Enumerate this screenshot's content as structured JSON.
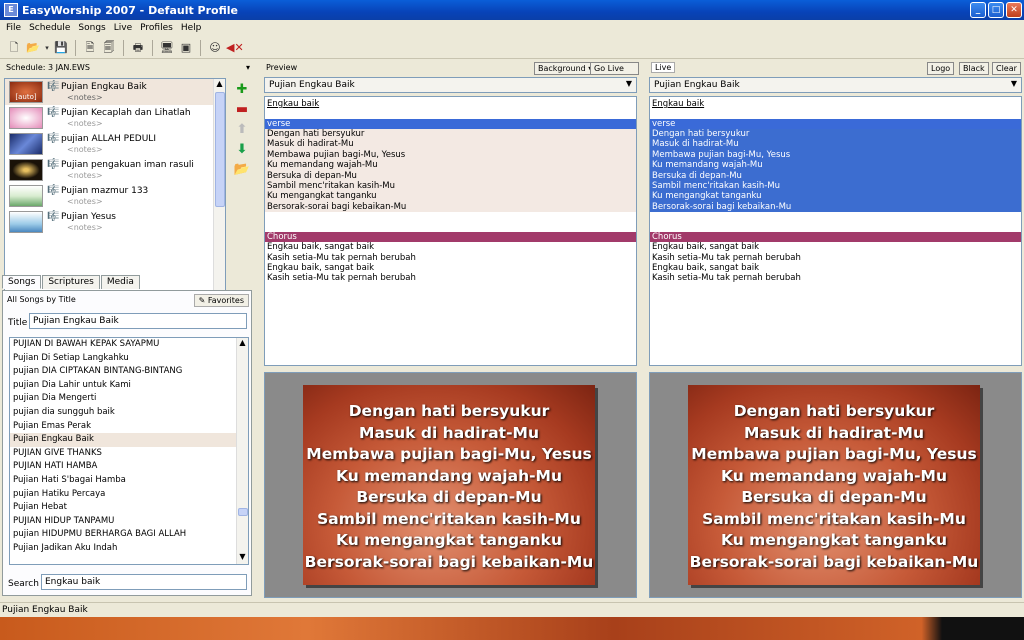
{
  "window": {
    "title": "EasyWorship 2007 - Default Profile"
  },
  "menu": [
    "File",
    "Schedule",
    "Songs",
    "Live",
    "Profiles",
    "Help"
  ],
  "schedule": {
    "label": "Schedule: 3 JAN.EWS",
    "items": [
      {
        "title": "Pujian Engkau Baik",
        "notes": "<notes>",
        "thumb_label": "[auto]",
        "thumb_color": "#8a2a10"
      },
      {
        "title": "Pujian Kecaplah dan Lihatlah",
        "notes": "<notes>",
        "thumb_label": "",
        "thumb_color": "#e48ab8"
      },
      {
        "title": "pujian ALLAH PEDULI",
        "notes": "<notes>",
        "thumb_label": "",
        "thumb_color": "#2a3c7a"
      },
      {
        "title": "Pujian pengakuan iman rasuli",
        "notes": "<notes>",
        "thumb_label": "",
        "thumb_color": "#1a1208"
      },
      {
        "title": "Pujian  mazmur 133",
        "notes": "<notes>",
        "thumb_label": "",
        "thumb_color": "#9cc89c"
      },
      {
        "title": "Pujian Yesus",
        "notes": "<notes>",
        "thumb_label": "",
        "thumb_color": "#7ab0dc"
      }
    ]
  },
  "tabs": [
    "Songs",
    "Scriptures",
    "Media"
  ],
  "songs": {
    "header": "All Songs by Title",
    "favorites_label": "Favorites",
    "title_label": "Title",
    "title_value": "Pujian Engkau Baik",
    "list": [
      "PUJIAN DI BAWAH KEPAK SAYAPMU",
      "Pujian Di Setiap Langkahku",
      "pujian DIA CIPTAKAN BINTANG-BINTANG",
      "pujian Dia Lahir untuk Kami",
      "pujian Dia Mengerti",
      "pujian dia sungguh baik",
      "Pujian Emas Perak",
      "Pujian Engkau Baik",
      "PUJIAN GIVE THANKS",
      "PUJIAN HATI HAMBA",
      "Pujian Hati S'bagai Hamba",
      "pujian Hatiku Percaya",
      "Pujian Hebat",
      "PUJIAN HIDUP  TANPAMU",
      "pujian HIDUPMU BERHARGA BAGI ALLAH",
      "Pujian Jadikan Aku Indah"
    ],
    "selected_index": 7,
    "search_label": "Search",
    "search_value": "Engkau baik"
  },
  "preview": {
    "label": "Preview",
    "background_btn": "Background ▾",
    "golive_btn": "Go Live >>>",
    "song": "Pujian Engkau Baik"
  },
  "live": {
    "label": "Live",
    "logo_btn": "Logo",
    "black_btn": "Black",
    "clear_btn": "Clear",
    "song": "Pujian Engkau Baik"
  },
  "lyrics": {
    "title": "Engkau baik",
    "verse_label": "verse",
    "verse": [
      "Dengan hati bersyukur",
      "Masuk di hadirat-Mu",
      "Membawa pujian bagi-Mu, Yesus",
      "Ku memandang wajah-Mu",
      "Bersuka di depan-Mu",
      "Sambil menc'ritakan kasih-Mu",
      "Ku mengangkat tanganku",
      "Bersorak-sorai bagi kebaikan-Mu"
    ],
    "chorus_label": "Chorus",
    "chorus": [
      "Engkau baik, sangat baik",
      "Kasih setia-Mu tak pernah berubah",
      "Engkau baik, sangat baik",
      "Kasih setia-Mu tak pernah berubah"
    ]
  },
  "colors": {
    "verse_header": "#3a6ad8",
    "chorus_header": "#a23a6a",
    "live_highlight": "#3c6dd0"
  },
  "statusbar": {
    "text": "Pujian Engkau Baik"
  }
}
